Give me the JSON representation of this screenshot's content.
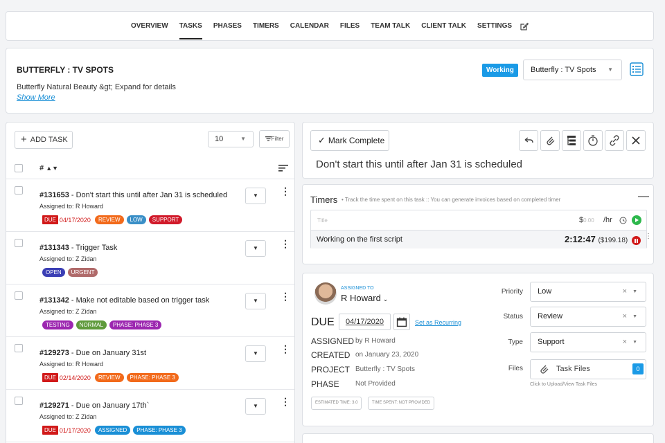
{
  "nav": {
    "tabs": [
      "OVERVIEW",
      "TASKS",
      "PHASES",
      "TIMERS",
      "CALENDAR",
      "FILES",
      "TEAM TALK",
      "CLIENT TALK",
      "SETTINGS"
    ],
    "active": "TASKS"
  },
  "project": {
    "title": "BUTTERFLY : TV SPOTS",
    "description": "Butterfly Natural Beauty &gt; Expand for details",
    "show_more": "Show More",
    "status_badge": "Working",
    "project_select": "Butterfly : TV Spots"
  },
  "tasklist": {
    "add_task": "ADD TASK",
    "per_page": "10",
    "filter": "Filter",
    "header_hash": "#",
    "rows": [
      {
        "id": "#131653",
        "title": "Don't start this until after Jan 31 is scheduled",
        "assigned": "Assigned to: R Howard",
        "due": "04/17/2020",
        "tags": [
          {
            "text": "REVIEW",
            "color": "#f26a1b"
          },
          {
            "text": "LOW",
            "color": "#3a8fc7"
          },
          {
            "text": "SUPPORT",
            "color": "#d11a2a"
          }
        ]
      },
      {
        "id": "#131343",
        "title": "Trigger Task",
        "assigned": "Assigned to: Z Zidan",
        "due": "",
        "tags": [
          {
            "text": "OPEN",
            "color": "#3b3fb5"
          },
          {
            "text": "URGENT",
            "color": "#b06a6a"
          }
        ]
      },
      {
        "id": "#131342",
        "title": "Make not editable based on trigger task",
        "assigned": "Assigned to: Z Zidan",
        "due": "",
        "tags": [
          {
            "text": "TESTING",
            "color": "#9c27b0"
          },
          {
            "text": "NORMAL",
            "color": "#5f9a3c"
          },
          {
            "text": "PHASE: PHASE 3",
            "color": "#9c27b0"
          }
        ]
      },
      {
        "id": "#129273",
        "title": "Due on January 31st",
        "assigned": "Assigned to: R Howard",
        "due": "02/14/2020",
        "tags": [
          {
            "text": "REVIEW",
            "color": "#f26a1b"
          },
          {
            "text": "PHASE: PHASE 3",
            "color": "#f26a1b"
          }
        ]
      },
      {
        "id": "#129271",
        "title": "Due on January 17th`",
        "assigned": "Assigned to: Z Zidan",
        "due": "01/17/2020",
        "tags": [
          {
            "text": "ASSIGNED",
            "color": "#1a8fd6"
          },
          {
            "text": "PHASE: PHASE 3",
            "color": "#1a8fd6"
          }
        ]
      }
    ],
    "due_label": "DUE"
  },
  "detail": {
    "mark_complete": "Mark Complete",
    "title": "Don't start this until after Jan 31 is scheduled"
  },
  "timers": {
    "heading": "Timers",
    "subtitle": "• Track the time spent on this task :: You can generate invoices based on completed timer",
    "title_placeholder": "Title",
    "rate_prefix": "$",
    "rate_value": "0.00",
    "per_hr": "/hr",
    "entry_name": "Working on the first script",
    "entry_time": "2:12:47",
    "entry_amount": "($199.18)"
  },
  "assignment": {
    "assigned_to_label": "ASSIGNED to",
    "assignee": "R Howard",
    "due_label": "DUE",
    "due_date": "04/17/2020",
    "set_recurring": "Set as Recurring",
    "assigned_label": "ASSIGNED",
    "assigned_value": "by R Howard",
    "created_label": "CREATED",
    "created_value": "on January 23, 2020",
    "project_label": "PROJECT",
    "project_value": "Butterfly : TV Spots",
    "phase_label": "PHASE",
    "phase_value": "Not Provided",
    "estimated": "ESTIMATED TIME: 3.0",
    "time_spent": "TIME SPENT: NOT PROVIDED",
    "priority_label": "Priority",
    "priority_value": "Low",
    "status_label": "Status",
    "status_value": "Review",
    "type_label": "Type",
    "type_value": "Support",
    "files_label": "Files",
    "files_value": "Task Files",
    "files_count": "0",
    "files_hint": "Click to Upload/View Task Files"
  }
}
